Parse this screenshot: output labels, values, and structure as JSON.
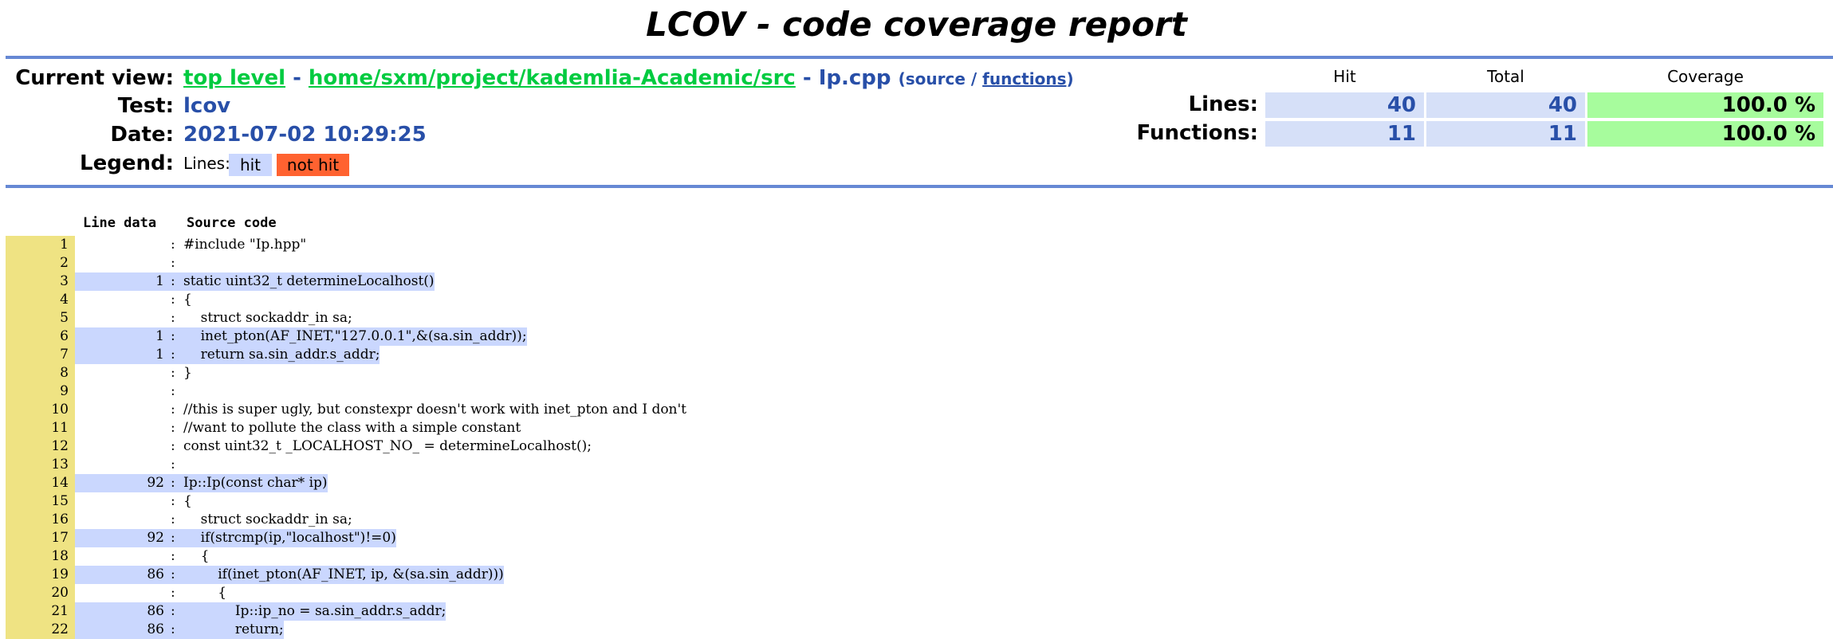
{
  "title": "LCOV - code coverage report",
  "header": {
    "current_view_label": "Current view:",
    "top_level": "top level",
    "sep1": "-",
    "path": "home/sxm/project/kademlia-Academic/src",
    "sep2": "-",
    "file": "Ip.cpp",
    "source_paren": "(source /",
    "functions_link": "functions",
    "close_paren": ")",
    "test_label": "Test:",
    "test_value": "lcov",
    "date_label": "Date:",
    "date_value": "2021-07-02 10:29:25",
    "legend_label": "Legend:",
    "legend_lines": "Lines:",
    "legend_hit": "hit",
    "legend_not_hit": "not hit"
  },
  "summary": {
    "col_hit": "Hit",
    "col_total": "Total",
    "col_coverage": "Coverage",
    "lines_label": "Lines:",
    "lines_hit": "40",
    "lines_total": "40",
    "lines_coverage": "100.0 %",
    "functions_label": "Functions:",
    "functions_hit": "11",
    "functions_total": "11",
    "functions_coverage": "100.0 %"
  },
  "colors": {
    "ruler": "#6688d4",
    "hit": "#cad7fe",
    "not_hit": "#ff6230",
    "line_number_bg": "#efe383",
    "coverage_high": "#a7fc9d"
  },
  "source": {
    "col_line_data": "Line data",
    "col_source_code": "Source code",
    "lines": [
      {
        "n": "1",
        "hits": "",
        "code": "#include \"Ip.hpp\""
      },
      {
        "n": "2",
        "hits": "",
        "code": ""
      },
      {
        "n": "3",
        "hits": "1",
        "code": "static uint32_t determineLocalhost()"
      },
      {
        "n": "4",
        "hits": "",
        "code": "{"
      },
      {
        "n": "5",
        "hits": "",
        "code": "    struct sockaddr_in sa;"
      },
      {
        "n": "6",
        "hits": "1",
        "code": "    inet_pton(AF_INET,\"127.0.0.1\",&(sa.sin_addr));"
      },
      {
        "n": "7",
        "hits": "1",
        "code": "    return sa.sin_addr.s_addr;"
      },
      {
        "n": "8",
        "hits": "",
        "code": "}"
      },
      {
        "n": "9",
        "hits": "",
        "code": ""
      },
      {
        "n": "10",
        "hits": "",
        "code": "//this is super ugly, but constexpr doesn't work with inet_pton and I don't"
      },
      {
        "n": "11",
        "hits": "",
        "code": "//want to pollute the class with a simple constant"
      },
      {
        "n": "12",
        "hits": "",
        "code": "const uint32_t _LOCALHOST_NO_ = determineLocalhost();"
      },
      {
        "n": "13",
        "hits": "",
        "code": ""
      },
      {
        "n": "14",
        "hits": "92",
        "code": "Ip::Ip(const char* ip)"
      },
      {
        "n": "15",
        "hits": "",
        "code": "{"
      },
      {
        "n": "16",
        "hits": "",
        "code": "    struct sockaddr_in sa;"
      },
      {
        "n": "17",
        "hits": "92",
        "code": "    if(strcmp(ip,\"localhost\")!=0)"
      },
      {
        "n": "18",
        "hits": "",
        "code": "    {"
      },
      {
        "n": "19",
        "hits": "86",
        "code": "        if(inet_pton(AF_INET, ip, &(sa.sin_addr)))"
      },
      {
        "n": "20",
        "hits": "",
        "code": "        {"
      },
      {
        "n": "21",
        "hits": "86",
        "code": "            Ip::ip_no = sa.sin_addr.s_addr;"
      },
      {
        "n": "22",
        "hits": "86",
        "code": "            return;"
      }
    ]
  }
}
